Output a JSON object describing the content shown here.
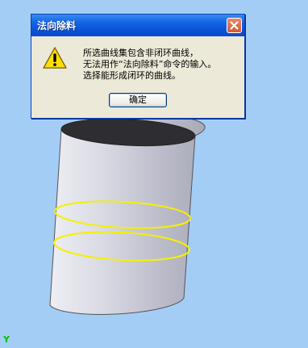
{
  "dialog": {
    "title": "法向除料",
    "message_lines": [
      "所选曲线集包含非闭环曲线，",
      "无法用作“法向除料”命令的输入。",
      "选择能形成闭环的曲线。"
    ],
    "ok_label": "确定",
    "icons": {
      "warning": "warning-icon",
      "close": "close-icon"
    }
  },
  "viewport": {
    "axis_label": "Y",
    "colors": {
      "background": "#a4cdf5",
      "cylinder": "#c8c9d6",
      "curve": "#f5f000"
    }
  }
}
